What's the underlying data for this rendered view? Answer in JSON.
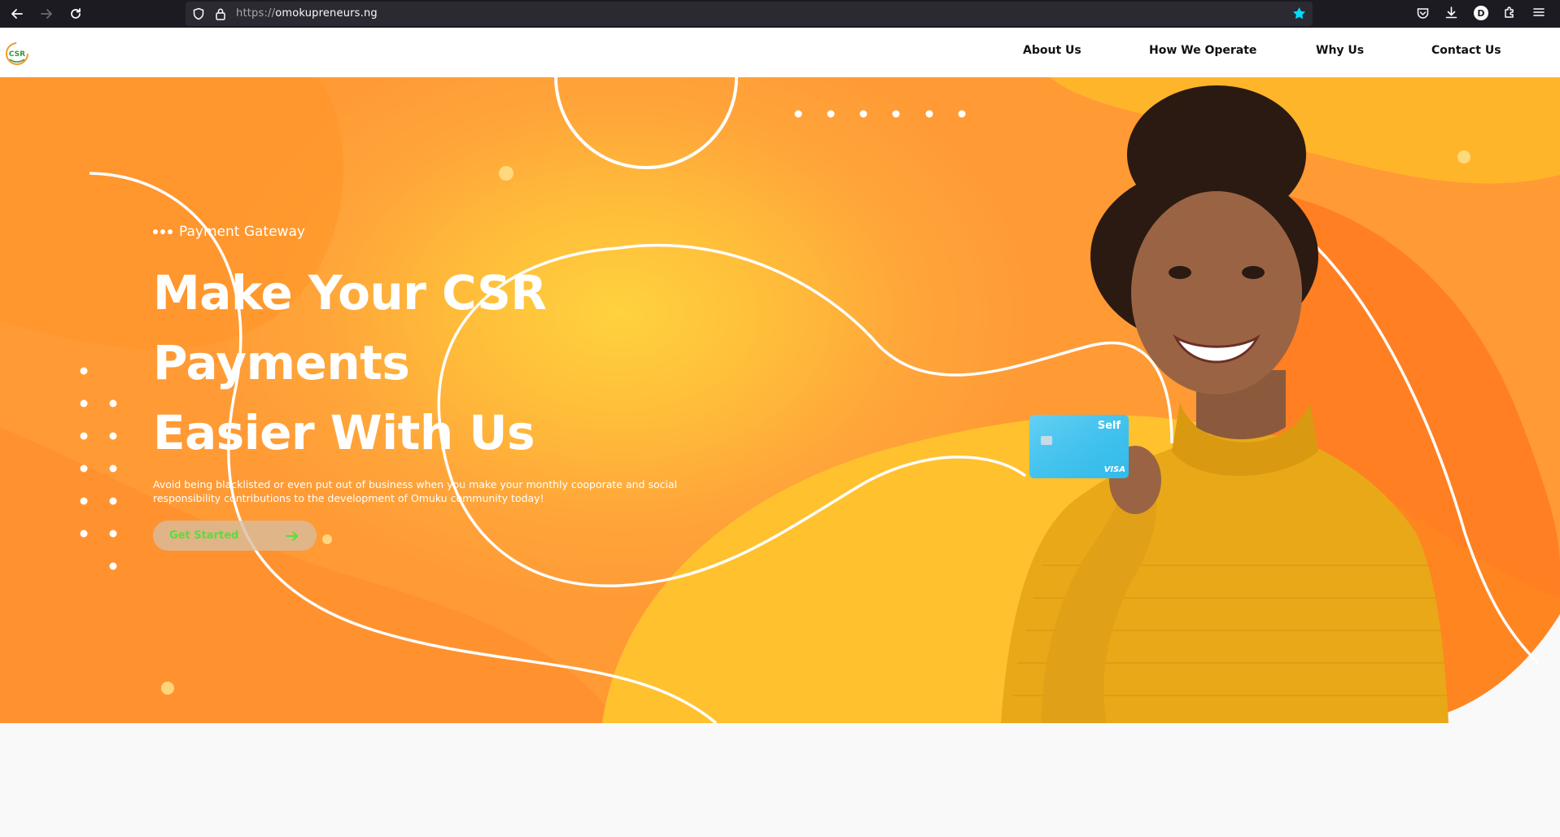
{
  "browser": {
    "url_scheme": "https://",
    "url_host": "omokupreneurs.ng",
    "profile_initial": "D"
  },
  "site": {
    "logo_text": "CSR",
    "nav": [
      {
        "label": "About Us"
      },
      {
        "label": "How We Operate"
      },
      {
        "label": "Why Us"
      },
      {
        "label": "Contact Us"
      }
    ]
  },
  "hero": {
    "eyebrow": "Payment Gateway",
    "title_lines": [
      "Make Your CSR",
      "Payments",
      "Easier With Us"
    ],
    "description": "Avoid being blacklisted or even put out of business when you make your monthly cooporate and social responsibility contributions to the development of Omuku community today!",
    "cta_label": "Get Started",
    "card": {
      "brand": "Self",
      "network": "VISA"
    }
  },
  "colors": {
    "hero_orange": "#ff9a35",
    "hero_yellow": "#ffd23f",
    "cta_text": "#55e03a",
    "browser_bg": "#1c1b22",
    "bookmark_star": "#00ddff"
  }
}
